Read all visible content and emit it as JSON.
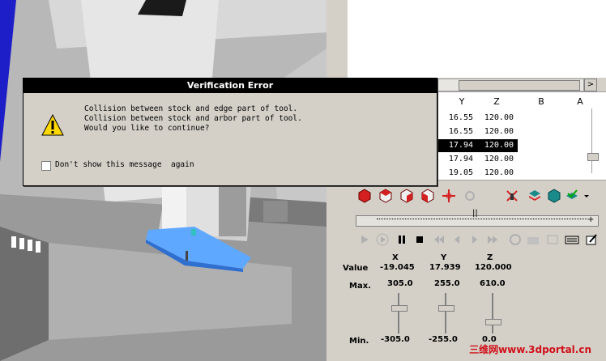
{
  "dialog": {
    "title": "Verification Error",
    "lines": [
      "Collision between stock and edge part of tool.",
      "Collision between stock and arbor part of tool.",
      "Would you like to continue?"
    ],
    "checkbox_label": "Don't show this message  again",
    "icon": "warning-icon"
  },
  "table": {
    "headers": [
      "Y",
      "Z",
      "B",
      "A"
    ],
    "rows": [
      {
        "y": "16.55",
        "z": "120.00",
        "selected": false
      },
      {
        "y": "16.55",
        "z": "120.00",
        "selected": false
      },
      {
        "y": "17.94",
        "z": "120.00",
        "selected": true
      },
      {
        "y": "17.94",
        "z": "120.00",
        "selected": false
      },
      {
        "y": "19.05",
        "z": "120.00",
        "selected": false
      }
    ]
  },
  "scroll_arrow": ">",
  "slider_marker": "||",
  "slider_minus": "-",
  "slider_plus": "+",
  "coords": {
    "axes": [
      "X",
      "Y",
      "Z"
    ],
    "value_label": "Value",
    "max_label": "Max.",
    "min_label": "Min.",
    "values": [
      "-19.045",
      "17.939",
      "120.000"
    ],
    "max": [
      "305.0",
      "255.0",
      "610.0"
    ],
    "min": [
      "-305.0",
      "-255.0",
      "0.0"
    ]
  },
  "watermark": "三维网www.3dportal.cn",
  "colors": {
    "accent_red": "#d42020",
    "selection": "#000000"
  }
}
